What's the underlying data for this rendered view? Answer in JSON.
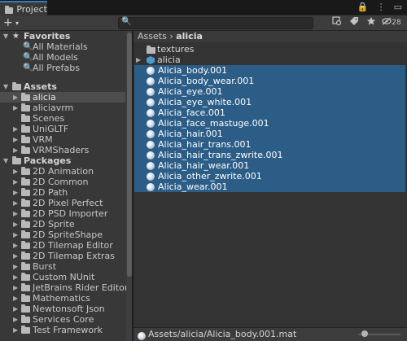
{
  "window": {
    "tab_label": "Project",
    "tab_icon": "folder-icon",
    "controls": [
      "🔒",
      "⋮",
      "▭"
    ]
  },
  "toolbar": {
    "add_label": "+",
    "add_caret": "▾",
    "search_value": "",
    "icons": [
      "search-by-type-icon",
      "search-by-label-icon",
      "favorite-star-icon",
      "hidden-packages-icon"
    ],
    "hidden_count": "28"
  },
  "tree": {
    "favorites": {
      "label": "Favorites",
      "items": [
        "All Materials",
        "All Models",
        "All Prefabs"
      ]
    },
    "assets": {
      "label": "Assets",
      "items": [
        "alicia",
        "aliciavrm",
        "Scenes",
        "UniGLTF",
        "VRM",
        "VRMShaders"
      ],
      "selected": "alicia"
    },
    "packages": {
      "label": "Packages",
      "items": [
        "2D Animation",
        "2D Common",
        "2D Path",
        "2D Pixel Perfect",
        "2D PSD Importer",
        "2D Sprite",
        "2D SpriteShape",
        "2D Tilemap Editor",
        "2D Tilemap Extras",
        "Burst",
        "Custom NUnit",
        "JetBrains Rider Editor",
        "Mathematics",
        "Newtonsoft Json",
        "Services Core",
        "Test Framework"
      ]
    }
  },
  "breadcrumb": {
    "root": "Assets",
    "separator": "›",
    "current": "alicia"
  },
  "files": [
    {
      "name": "textures",
      "kind": "folder",
      "selected": false
    },
    {
      "name": "alicia",
      "kind": "prefab",
      "selected": false
    },
    {
      "name": "Alicia_body.001",
      "kind": "material",
      "selected": true
    },
    {
      "name": "Alicia_body_wear.001",
      "kind": "material",
      "selected": true
    },
    {
      "name": "Alicia_eye.001",
      "kind": "material",
      "selected": true
    },
    {
      "name": "Alicia_eye_white.001",
      "kind": "material",
      "selected": true
    },
    {
      "name": "Alicia_face.001",
      "kind": "material",
      "selected": true
    },
    {
      "name": "Alicia_face_mastuge.001",
      "kind": "material",
      "selected": true
    },
    {
      "name": "Alicia_hair.001",
      "kind": "material",
      "selected": true
    },
    {
      "name": "Alicia_hair_trans.001",
      "kind": "material",
      "selected": true
    },
    {
      "name": "Alicia_hair_trans_zwrite.001",
      "kind": "material",
      "selected": true
    },
    {
      "name": "Alicia_hair_wear.001",
      "kind": "material",
      "selected": true
    },
    {
      "name": "Alicia_other_zwrite.001",
      "kind": "material",
      "selected": true
    },
    {
      "name": "Alicia_wear.001",
      "kind": "material",
      "selected": true
    }
  ],
  "status": {
    "path": "Assets/alicia/Alicia_body.001.mat",
    "icon_size_fraction": 0.1
  },
  "colors": {
    "selection": "#2c5d87",
    "tab_accent": "#3a79bb",
    "panel": "#383838"
  }
}
